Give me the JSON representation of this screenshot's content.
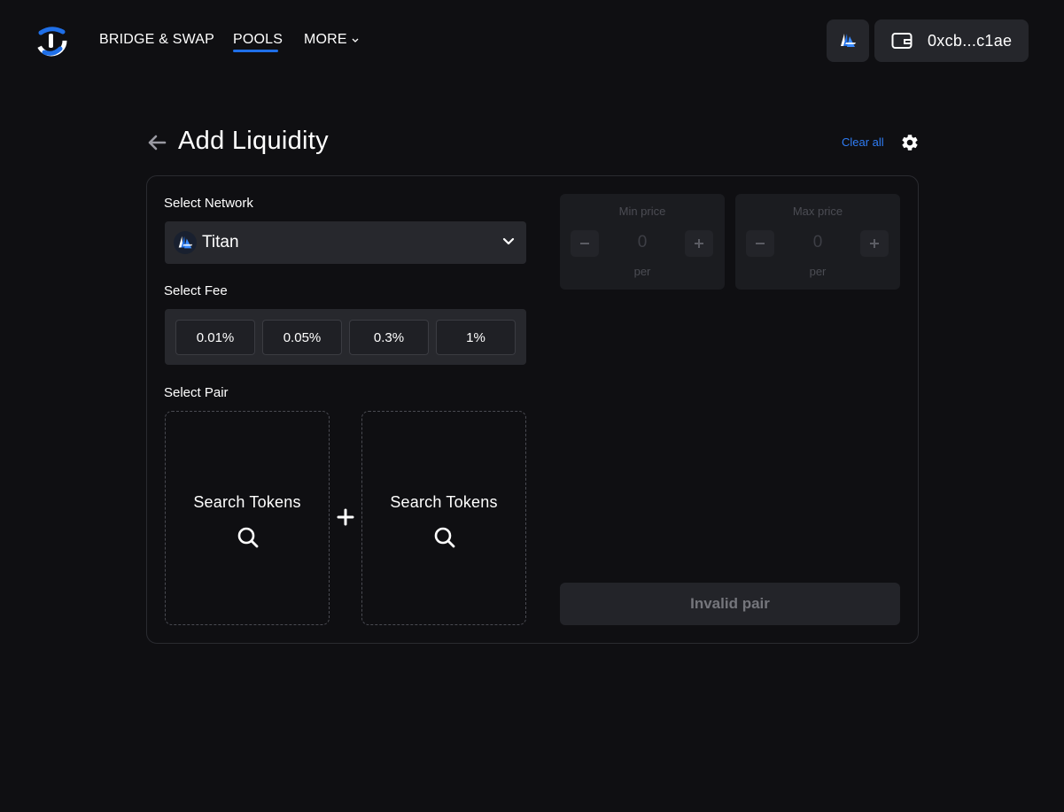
{
  "header": {
    "nav": {
      "bridge_swap": "BRIDGE & SWAP",
      "pools": "POOLS",
      "more": "MORE"
    },
    "wallet_address": "0xcb...c1ae",
    "icons": {
      "logo": "app-logo",
      "network": "titan-network-icon",
      "wallet": "wallet-icon",
      "more_chevron": "chevron-down-icon"
    }
  },
  "page": {
    "title": "Add Liquidity",
    "clear_all": "Clear all"
  },
  "form": {
    "network": {
      "label": "Select Network",
      "selected": "Titan"
    },
    "fee": {
      "label": "Select Fee",
      "options": [
        "0.01%",
        "0.05%",
        "0.3%",
        "1%"
      ]
    },
    "pair": {
      "label": "Select Pair",
      "token_a": "Search Tokens",
      "token_b": "Search Tokens"
    }
  },
  "price_range": {
    "min": {
      "title": "Min price",
      "value": "0",
      "per": "per"
    },
    "max": {
      "title": "Max price",
      "value": "0",
      "per": "per"
    }
  },
  "submit_label": "Invalid pair",
  "colors": {
    "background": "#0f0f12",
    "accent": "#1f6fe8",
    "link": "#2f7df6",
    "panel": "#27282d"
  }
}
